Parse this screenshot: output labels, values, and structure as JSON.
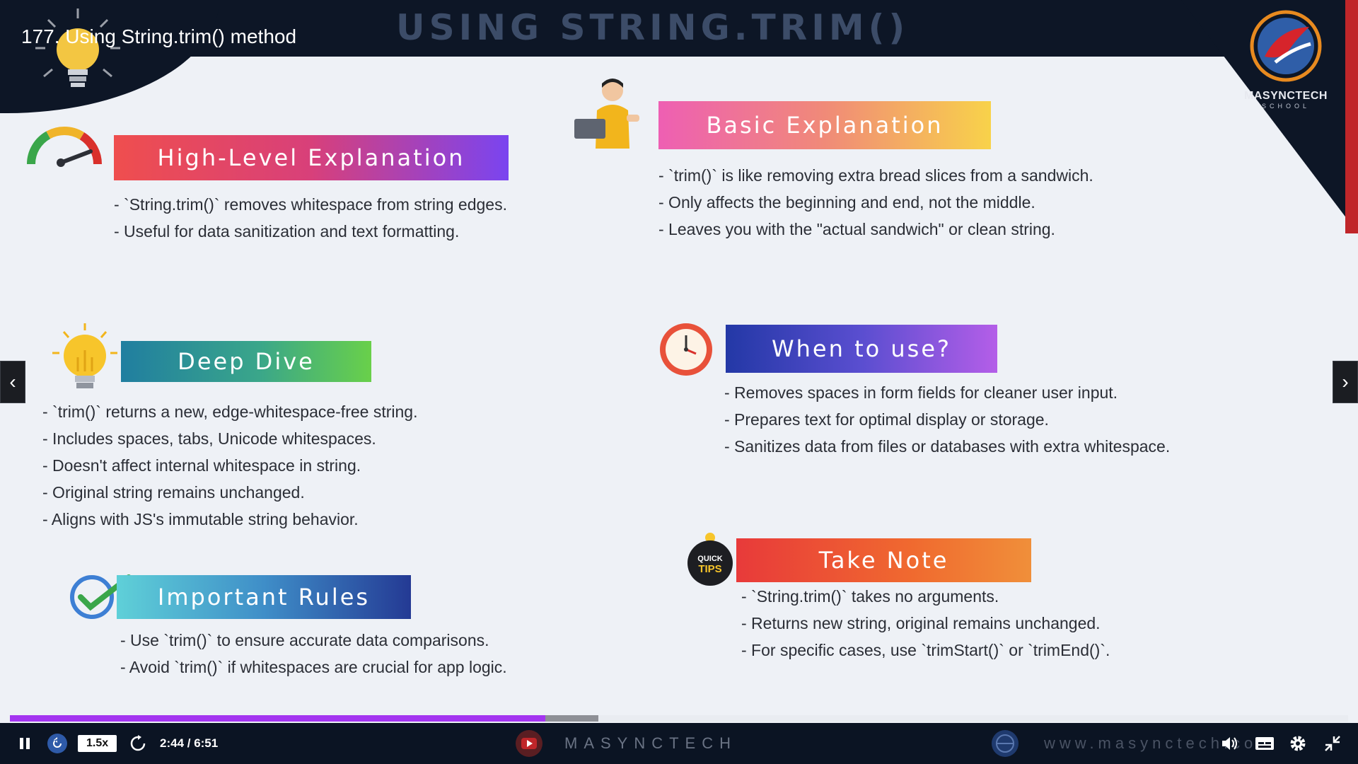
{
  "video": {
    "title": "177. Using String.trim() method",
    "slide_title": "USING STRING.TRIM()"
  },
  "logo": {
    "name": "MASYNCTECH",
    "sub": "SCHOOL"
  },
  "sections": {
    "high_level": {
      "heading": "High-Level Explanation",
      "lines": [
        "- `String.trim()` removes whitespace from string edges.",
        "- Useful for data sanitization and text formatting."
      ]
    },
    "basic": {
      "heading": "Basic Explanation",
      "lines": [
        "- `trim()` is like removing extra bread slices from a sandwich.",
        "- Only affects the beginning and end, not the middle.",
        "- Leaves you with the \"actual sandwich\" or clean string."
      ]
    },
    "deep_dive": {
      "heading": "Deep Dive",
      "lines": [
        "- `trim()` returns a new, edge-whitespace-free string.",
        "- Includes spaces, tabs, Unicode whitespaces.",
        "- Doesn't affect internal whitespace in string.",
        "- Original string remains unchanged.",
        "- Aligns with JS's immutable string behavior."
      ]
    },
    "when_to_use": {
      "heading": "When to use?",
      "lines": [
        "- Removes spaces in form fields for cleaner user input.",
        "- Prepares text for optimal display or storage.",
        "- Sanitizes data from files or databases with extra whitespace."
      ]
    },
    "rules": {
      "heading": "Important Rules",
      "lines": [
        "- Use `trim()` to ensure accurate data comparisons.",
        "- Avoid `trim()` if whitespaces are crucial for app logic."
      ]
    },
    "take_note": {
      "heading": "Take Note",
      "badge_top": "QUICK",
      "badge_bottom": "TIPS",
      "lines": [
        "- `String.trim()` takes no arguments.",
        "- Returns new string, original remains unchanged.",
        "- For specific cases, use `trimStart()` or `trimEnd()`."
      ]
    }
  },
  "player": {
    "playback_rate": "1.5x",
    "time_display": "2:44 / 6:51",
    "progress_fraction": 0.4,
    "buffered_fraction": 0.44,
    "footer_brand": "MASYNCTECH",
    "footer_web": "www.masynctech.com",
    "accent_color": "#a435f0"
  },
  "icons": [
    "pause-icon",
    "rewind-icon",
    "forward-icon",
    "volume-icon",
    "captions-icon",
    "settings-icon",
    "fullscreen-exit-icon",
    "prev-arrow-icon",
    "next-arrow-icon"
  ]
}
